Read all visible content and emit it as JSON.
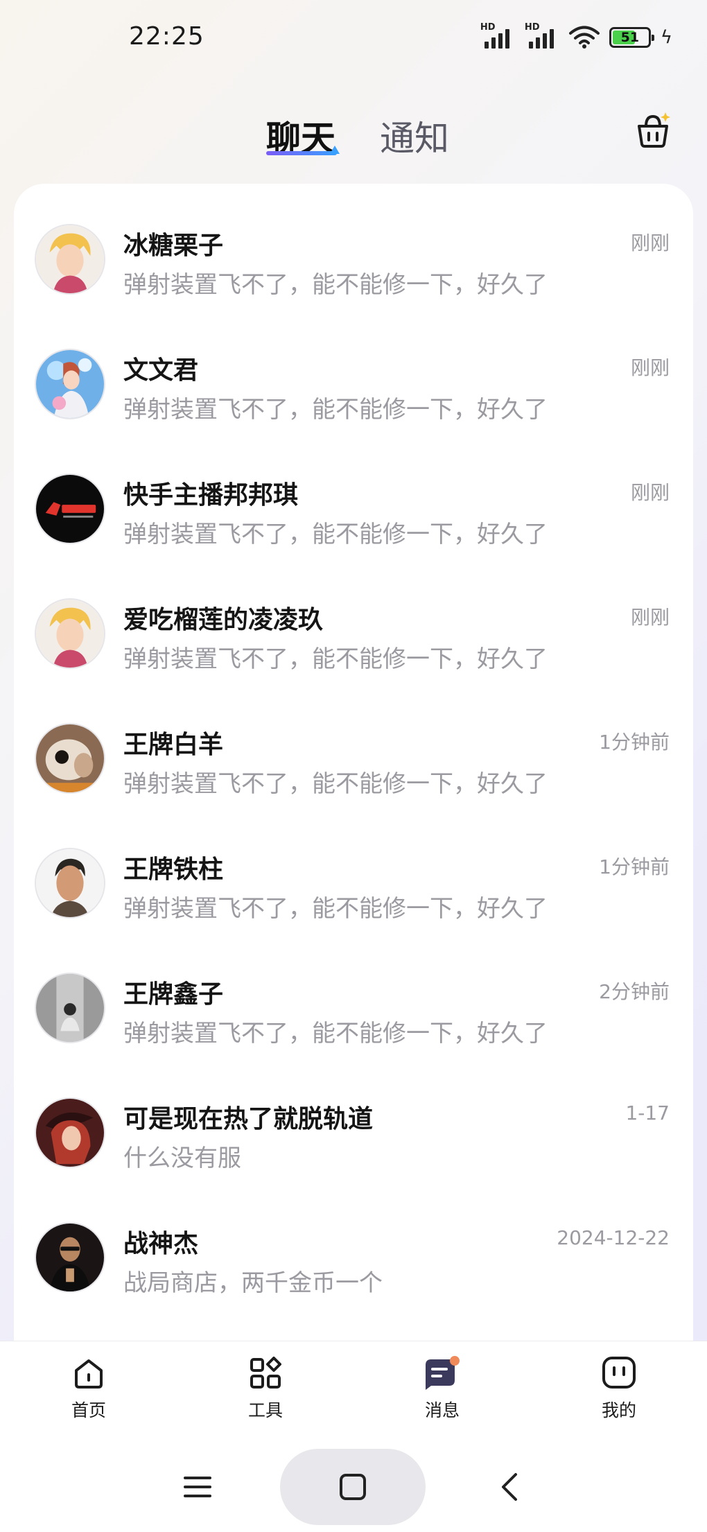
{
  "status_bar": {
    "time": "22:25",
    "battery": "51",
    "hd_label": "HD"
  },
  "tabs": {
    "chat": "聊天",
    "notify": "通知"
  },
  "chats": [
    {
      "name": "冰糖栗子",
      "message": "弹射装置飞不了，能不能修一下，好久了",
      "time": "刚刚",
      "avatar": "anime-blonde-avatar"
    },
    {
      "name": "文文君",
      "message": "弹射装置飞不了，能不能修一下，好久了",
      "time": "刚刚",
      "avatar": "anime-girl-blue-avatar"
    },
    {
      "name": "快手主播邦邦琪",
      "message": "弹射装置飞不了，能不能修一下，好久了",
      "time": "刚刚",
      "avatar": "hero-games-logo-avatar"
    },
    {
      "name": "爱吃榴莲的凌凌玖",
      "message": "弹射装置飞不了，能不能修一下，好久了",
      "time": "刚刚",
      "avatar": "anime-blonde-avatar"
    },
    {
      "name": "王牌白羊",
      "message": "弹射装置飞不了，能不能修一下，好久了",
      "time": "1分钟前",
      "avatar": "animal-photo-avatar"
    },
    {
      "name": "王牌铁柱",
      "message": "弹射装置飞不了，能不能修一下，好久了",
      "time": "1分钟前",
      "avatar": "game-character-avatar"
    },
    {
      "name": "王牌鑫子",
      "message": "弹射装置飞不了，能不能修一下，好久了",
      "time": "2分钟前",
      "avatar": "person-photo-avatar"
    },
    {
      "name": "可是现在热了就脱轨道",
      "message": "什么没有服",
      "time": "1-17",
      "avatar": "red-hair-character-avatar"
    },
    {
      "name": "战神杰",
      "message": "战局商店，两千金币一个",
      "time": "2024-12-22",
      "avatar": "dark-suit-avatar"
    }
  ],
  "bottom_nav": {
    "home": "首页",
    "tools": "工具",
    "messages": "消息",
    "me": "我的"
  },
  "colors": {
    "accent_gradient_start": "#7a5cf5",
    "accent_gradient_end": "#3aa0ff",
    "badge": "#f08a5a",
    "message_icon": "#3b3a5c"
  }
}
